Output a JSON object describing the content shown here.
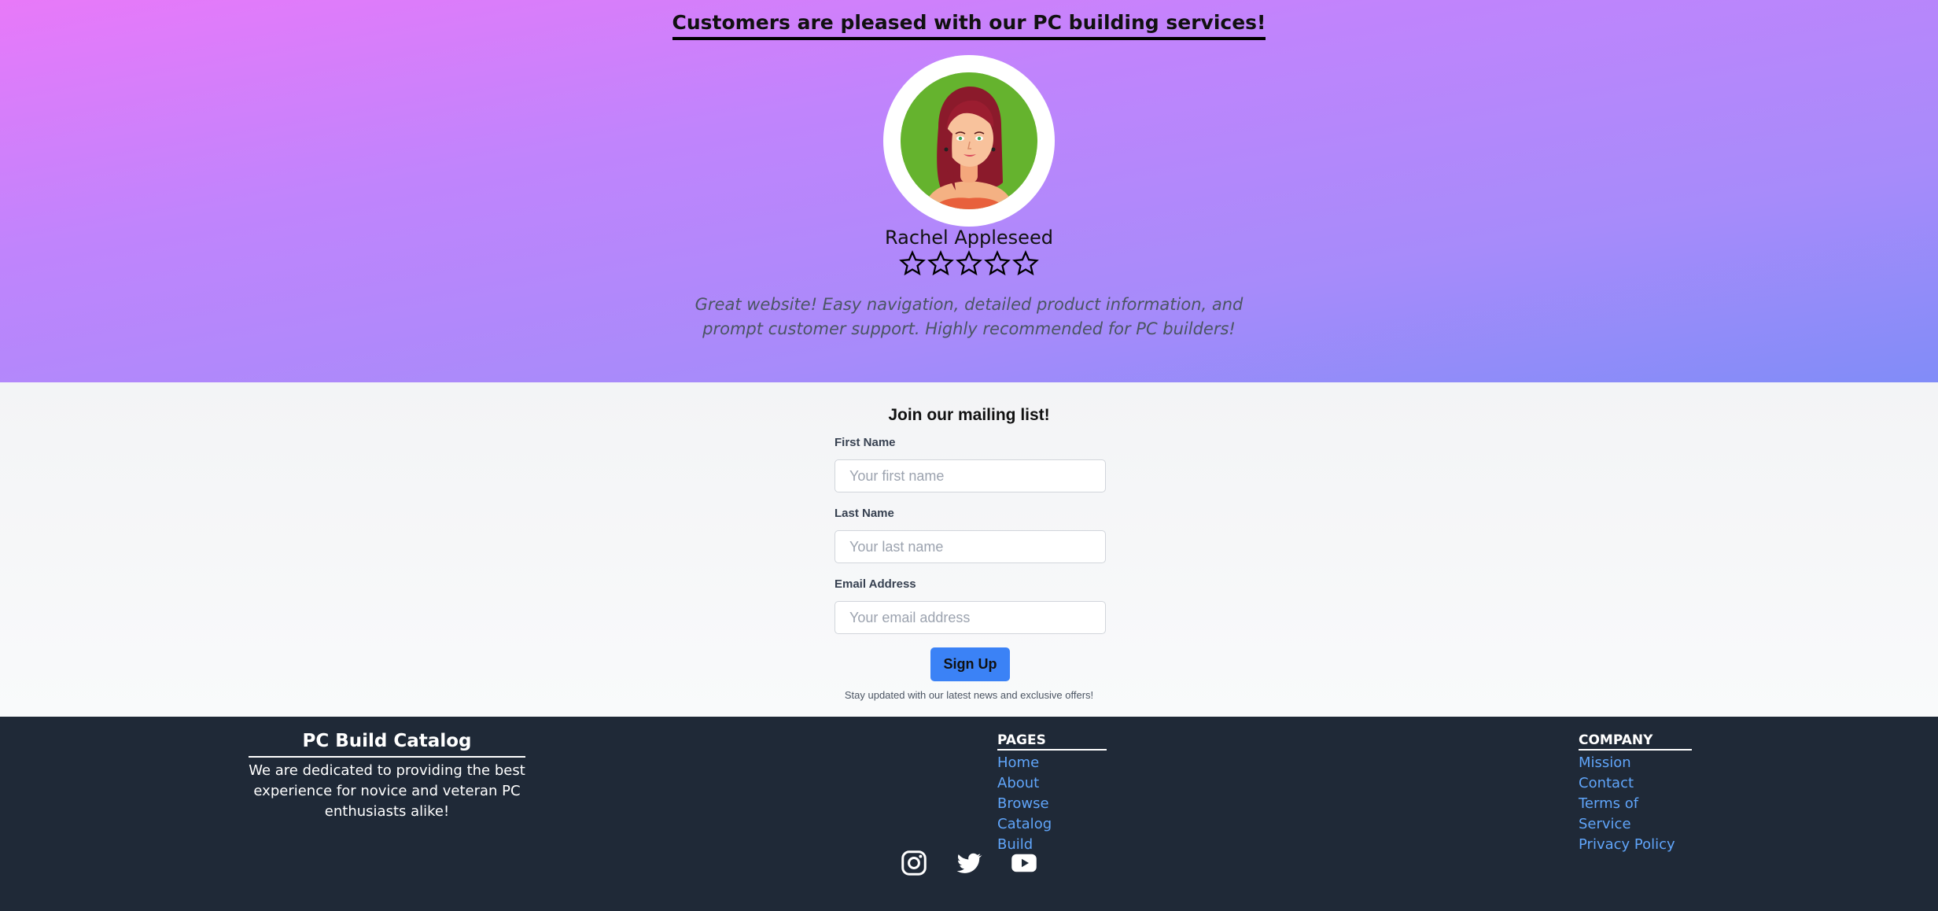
{
  "testimonial": {
    "title": "Customers are pleased with our PC building services!",
    "name": "Rachel Appleseed",
    "rating": 0,
    "rating_max": 5,
    "review_line1": "Great website! Easy navigation, detailed product information, and",
    "review_line2": "prompt customer support. Highly recommended for PC builders!"
  },
  "mailing": {
    "title": "Join our mailing list!",
    "first_name_label": "First Name",
    "first_name_placeholder": "Your first name",
    "last_name_label": "Last Name",
    "last_name_placeholder": "Your last name",
    "email_label": "Email Address",
    "email_placeholder": "Your email address",
    "signup_label": "Sign Up",
    "note": "Stay updated with our latest news and exclusive offers!"
  },
  "footer": {
    "brand_name": "PC Build Catalog",
    "brand_desc_line1": "We are dedicated to providing the best",
    "brand_desc_line2": "experience for novice and veteran PC",
    "brand_desc_line3": "enthusiasts alike!",
    "pages": {
      "heading": "PAGES",
      "links": [
        "Home",
        "About",
        "Browse Catalog",
        "Build"
      ]
    },
    "company": {
      "heading": "COMPANY",
      "links": [
        "Mission",
        "Contact",
        "Terms of Service",
        "Privacy Policy"
      ]
    },
    "socials": [
      "instagram-icon",
      "twitter-icon",
      "youtube-icon"
    ]
  },
  "colors": {
    "gradient_start": "#e879f9",
    "gradient_end": "#818cf8",
    "button": "#3b82f6",
    "footer_bg": "#1f2937",
    "link": "#60a5fa"
  }
}
